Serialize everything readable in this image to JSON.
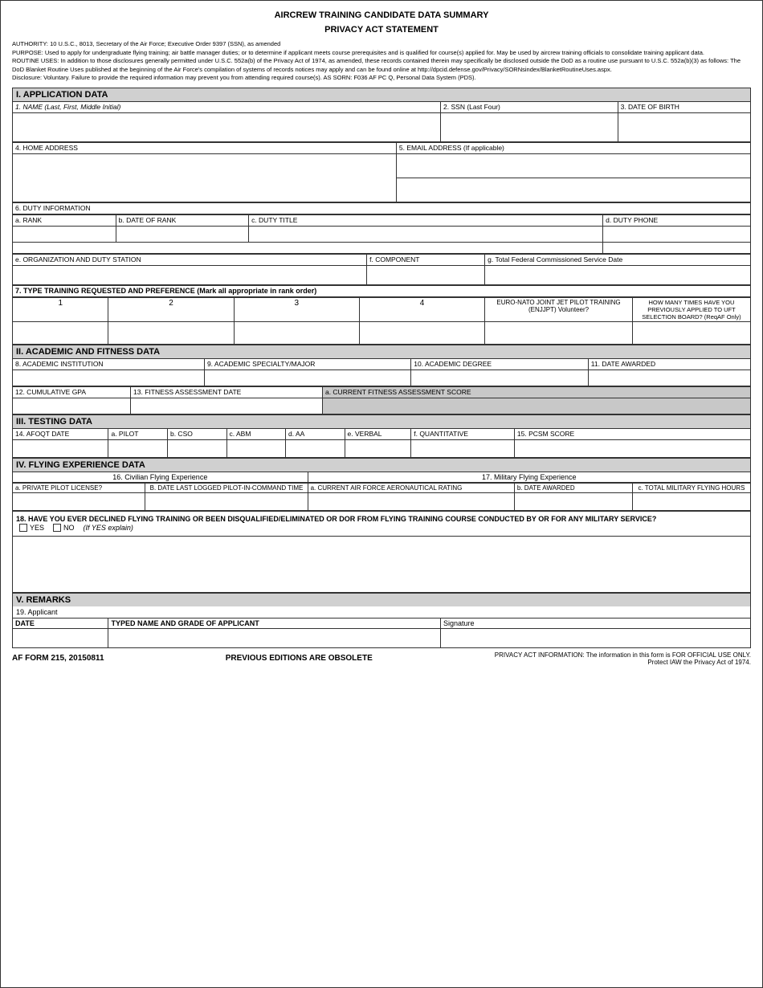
{
  "title": {
    "line1": "AIRCREW TRAINING CANDIDATE DATA SUMMARY",
    "line2": "PRIVACY ACT STATEMENT"
  },
  "authority": {
    "text1": "AUTHORITY: 10 U.S.C., 8013, Secretary of the Air Force; Executive Order 9397 (SSN), as amended",
    "text2": "PURPOSE: Used to apply for undergraduate flying training; air battle manager duties; or to determine if applicant meets course prerequisites and is qualified for course(s) applied for.  May be used by aircrew training officials to consolidate training applicant data.",
    "text3": "ROUTINE USES: In addition to those disclosures generally permitted under U.S.C. 552a(b) of the Privacy Act of 1974, as amended, these records contained therein may specifically be disclosed outside the DoD as a routine use pursuant to U.S.C. 552a(b)(3) as follows: The DoD Blanket Routine Uses published at the beginning of the Air Force's compilation of systems of records notices may apply and can be found online at http://dpcid.defense.gov/Privacy/SORNsindex/BlanketRoutineUses.aspx.",
    "text4": "Disclosure: Voluntary. Failure to provide the required information may prevent you from attending required course(s).  AS SORN: F036 AF PC Q, Personal Data System (PDS)."
  },
  "sections": {
    "application": "I. APPLICATION DATA",
    "academic": "II. ACADEMIC AND FITNESS DATA",
    "testing": "III. TESTING DATA",
    "flying": "IV. FLYING EXPERIENCE DATA",
    "remarks": "V. REMARKS"
  },
  "fields": {
    "name_label": "1. NAME (Last, First, Middle Initial)",
    "ssn_label": "2. SSN (Last Four)",
    "dob_label": "3. DATE OF BIRTH",
    "home_address_label": "4. HOME ADDRESS",
    "email_label": "5. EMAIL ADDRESS (If applicable)",
    "duty_info_label": "6. DUTY INFORMATION",
    "rank_label": "a. RANK",
    "date_of_rank_label": "b. DATE OF RANK",
    "duty_title_label": "c. DUTY TITLE",
    "duty_phone_label": "d. DUTY PHONE",
    "org_label": "e. ORGANIZATION AND DUTY STATION",
    "component_label": "f. COMPONENT",
    "federal_service_label": "g. Total Federal Commissioned Service Date",
    "type_training_label": "7. TYPE TRAINING REQUESTED AND PREFERENCE (Mark all appropriate in rank order)",
    "col1": "1",
    "col2": "2",
    "col3": "3",
    "col4": "4",
    "enjjpt_label": "EURO-NATO JOINT JET PILOT TRAINING (ENJJPT) Volunteer?",
    "how_many_label": "HOW MANY TIMES HAVE YOU PREVIOUSLY APPLIED TO UFT SELECTION BOARD? (ReqAF Only)",
    "academic_institution_label": "8. ACADEMIC INSTITUTION",
    "specialty_label": "9. ACADEMIC SPECIALTY/MAJOR",
    "degree_label": "10. ACADEMIC DEGREE",
    "date_awarded_label": "11. DATE AWARDED",
    "gpa_label": "12. CUMULATIVE GPA",
    "fitness_date_label": "13. FITNESS ASSESSMENT DATE",
    "fitness_score_label": "a. CURRENT FITNESS ASSESSMENT SCORE",
    "afoqt_date_label": "14. AFOQT DATE",
    "pilot_label": "a. PILOT",
    "cso_label": "b. CSO",
    "abm_label": "c. ABM",
    "aa_label": "d. AA",
    "verbal_label": "e. VERBAL",
    "quantitative_label": "f. QUANTITATIVE",
    "pcsm_label": "15. PCSM SCORE",
    "civilian_flying_label": "16. Civilian Flying Experience",
    "military_flying_label": "17. Military Flying Experience",
    "private_pilot_label": "a. PRIVATE PILOT LICENSE?",
    "date_last_logged_label": "B. DATE LAST LOGGED PILOT-IN-COMMAND TIME",
    "af_aero_label": "a. CURRENT AIR FORCE AERONAUTICAL RATING",
    "date_awarded2_label": "b. DATE AWARDED",
    "total_military_label": "c. TOTAL MILITARY FLYING HOURS",
    "flying_training_question": "18. HAVE YOU EVER DECLINED FLYING TRAINING OR BEEN DISQUALIFIED/ELIMINATED OR DOR FROM FLYING TRAINING COURSE CONDUCTED BY OR FOR ANY MILITARY SERVICE?",
    "yes_label": "YES",
    "no_label": "NO",
    "if_yes_label": "(If YES explain)",
    "remarks19_label": "19. Applicant",
    "date_sig_label": "DATE",
    "typed_name_label": "TYPED NAME AND GRADE OF APPLICANT",
    "signature_label": "Signature"
  },
  "footer": {
    "form_number": "AF FORM 215, 20150811",
    "center_text": "PREVIOUS EDITIONS ARE OBSOLETE",
    "right_text": "PRIVACY ACT INFORMATION: The information in this form is FOR OFFICIAL USE ONLY.  Protect IAW the Privacy Act of 1974."
  }
}
